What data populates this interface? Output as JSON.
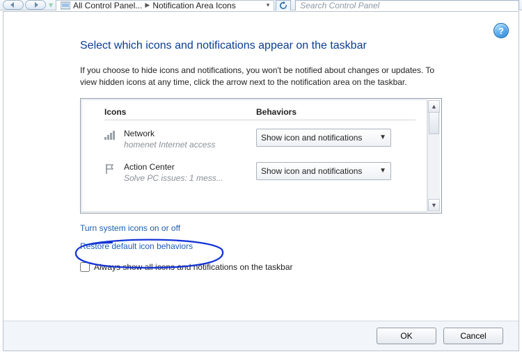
{
  "nav": {
    "crumb1": "All Control Panel...",
    "crumb2": "Notification Area Icons",
    "search_placeholder": "Search Control Panel"
  },
  "title": "Select which icons and notifications appear on the taskbar",
  "description": "If you choose to hide icons and notifications, you won't be notified about changes or updates. To view hidden icons at any time, click the arrow next to the notification area on the taskbar.",
  "columns": {
    "icons": "Icons",
    "behaviors": "Behaviors"
  },
  "items": [
    {
      "name": "Network",
      "sub": "homenet Internet access",
      "behavior": "Show icon and notifications"
    },
    {
      "name": "Action Center",
      "sub": "Solve PC issues: 1 mess...",
      "behavior": "Show icon and notifications"
    }
  ],
  "links": {
    "system_icons": "Turn system icons on or off",
    "restore": "Restore default icon behaviors"
  },
  "checkbox_label": "Always show all icons and notifications on the taskbar",
  "buttons": {
    "ok": "OK",
    "cancel": "Cancel"
  }
}
